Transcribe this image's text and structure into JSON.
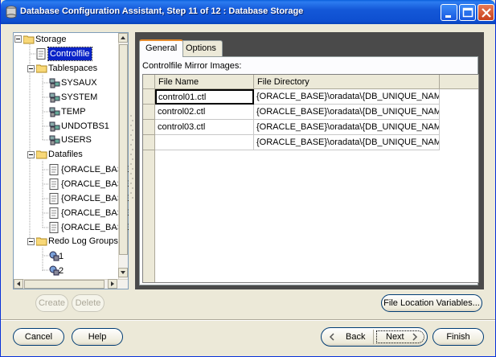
{
  "window": {
    "title": "Database Configuration Assistant, Step 11 of 12 : Database Storage"
  },
  "tree": {
    "storage": "Storage",
    "controlfile": "Controlfile",
    "tablespaces": "Tablespaces",
    "tablespace_items": [
      "SYSAUX",
      "SYSTEM",
      "TEMP",
      "UNDOTBS1",
      "USERS"
    ],
    "datafiles": "Datafiles",
    "datafile_items": [
      "{ORACLE_BASE",
      "{ORACLE_BASE",
      "{ORACLE_BASE",
      "{ORACLE_BASE",
      "{ORACLE_BASE"
    ],
    "redo": "Redo Log Groups",
    "redo_items": [
      "1",
      "2"
    ]
  },
  "tabs": {
    "general": "General",
    "options": "Options"
  },
  "controlfile": {
    "label": "Controlfile Mirror Images:",
    "columns": [
      "File Name",
      "File Directory"
    ],
    "rows": [
      [
        "control01.ctl",
        "{ORACLE_BASE}\\oradata\\{DB_UNIQUE_NAME}\\"
      ],
      [
        "control02.ctl",
        "{ORACLE_BASE}\\oradata\\{DB_UNIQUE_NAME}\\"
      ],
      [
        "control03.ctl",
        "{ORACLE_BASE}\\oradata\\{DB_UNIQUE_NAME}\\"
      ],
      [
        "",
        "{ORACLE_BASE}\\oradata\\{DB_UNIQUE_NAME}\\"
      ]
    ]
  },
  "buttons": {
    "create": "Create",
    "delete": "Delete",
    "file_location": "File Location Variables...",
    "cancel": "Cancel",
    "help": "Help",
    "back": "Back",
    "next": "Next",
    "finish": "Finish"
  }
}
